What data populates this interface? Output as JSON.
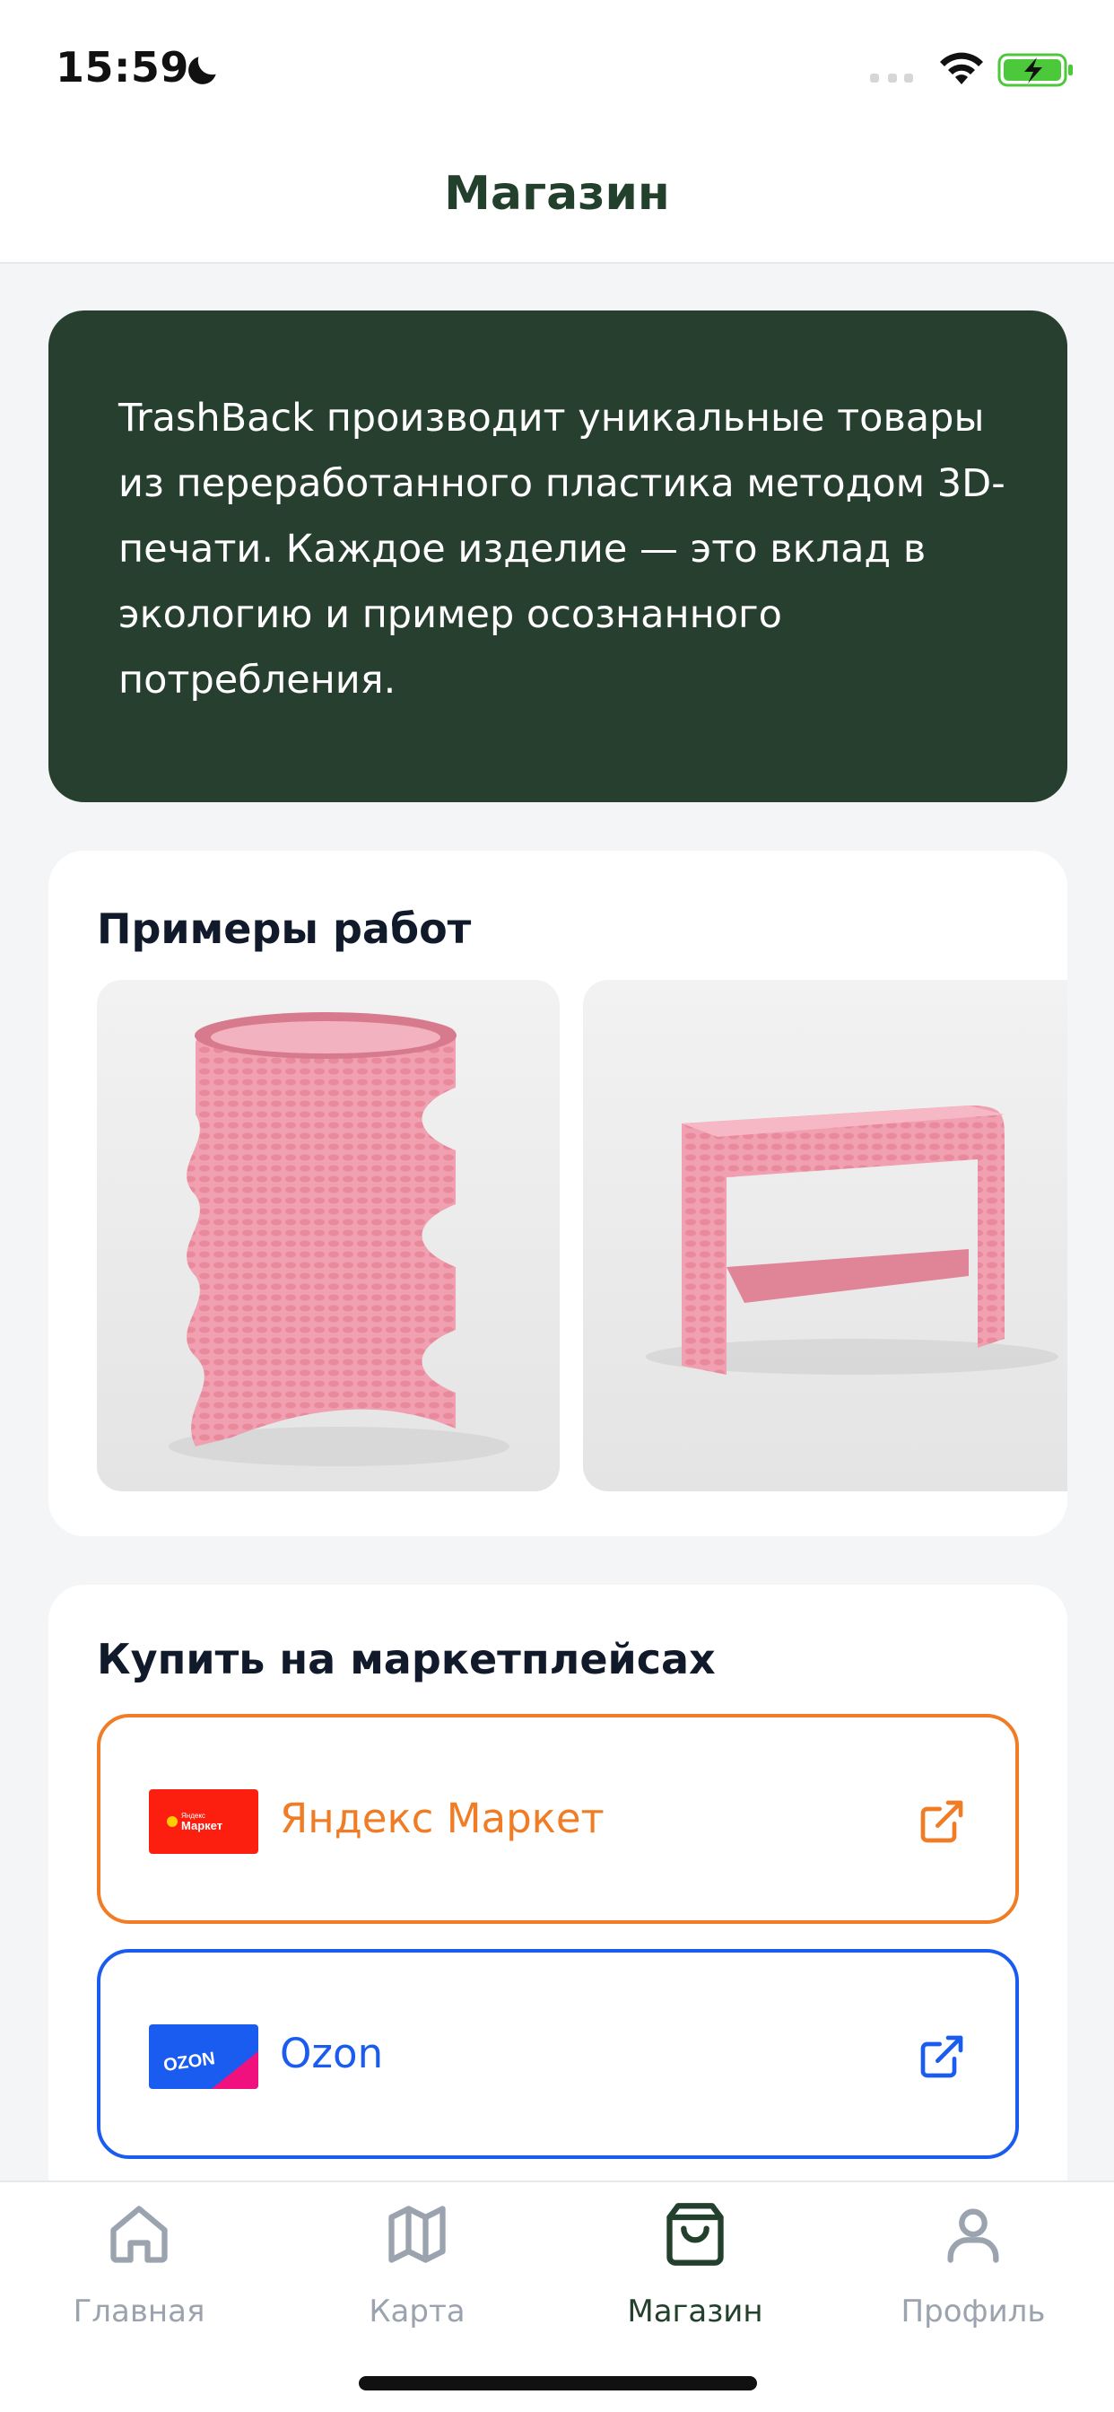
{
  "status_bar": {
    "time": "15:59",
    "icons": [
      "moon-icon",
      "signal-icon",
      "wifi-icon",
      "battery-charging-icon"
    ]
  },
  "header": {
    "title": "Магазин"
  },
  "intro": {
    "text": "TrashBack производит уникальные товары из переработанного пластика методом 3D-печати. Каждое изделие — это вклад в экологию и пример осознанного потребления."
  },
  "examples": {
    "title": "Примеры работ",
    "photos": [
      "pink-3d-printed-wavy-stand-photo",
      "pink-3d-printed-stool-photo"
    ]
  },
  "marketplaces": {
    "title": "Купить на маркетплейсах",
    "items": [
      {
        "label": "Яндекс Маркет",
        "logo": "yandex-market-logo",
        "logo_text_small": "Яндекс",
        "logo_text": "Маркет",
        "accent": "#f07d26"
      },
      {
        "label": "Ozon",
        "logo": "ozon-logo",
        "logo_text": "OZON",
        "accent": "#1b5cf0"
      }
    ]
  },
  "tab_bar": {
    "items": [
      {
        "label": "Главная",
        "icon": "home-icon",
        "active": false
      },
      {
        "label": "Карта",
        "icon": "map-icon",
        "active": false
      },
      {
        "label": "Магазин",
        "icon": "shopping-bag-icon",
        "active": true
      },
      {
        "label": "Профиль",
        "icon": "user-icon",
        "active": false
      }
    ]
  },
  "colors": {
    "brand_dark_green": "#263f2f",
    "title_green": "#23402c",
    "yandex_orange": "#f07d26",
    "ozon_blue": "#1b5cf0",
    "inactive_tab": "#9aa3ae",
    "background": "#f4f5f7"
  }
}
